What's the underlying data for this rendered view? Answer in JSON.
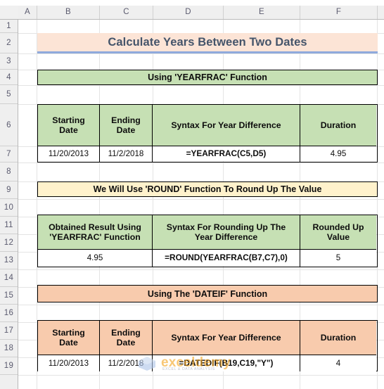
{
  "spreadsheet": {
    "columns": [
      "A",
      "B",
      "C",
      "D",
      "E",
      "F"
    ],
    "rows": [
      "1",
      "2",
      "3",
      "4",
      "5",
      "6",
      "7",
      "8",
      "9",
      "10",
      "11",
      "12",
      "13",
      "14",
      "15",
      "16",
      "17",
      "18",
      "19"
    ],
    "corner_name": "select-all-corner"
  },
  "title_banner": {
    "text": "Calculate Years Between Two Dates",
    "background": "#FCE4D6",
    "text_color": "#44546A",
    "underline_color": "#8FAADC",
    "cell_range": "B2:F2"
  },
  "section_1": {
    "banner": {
      "text": "Using 'YEARFRAC' Function",
      "background": "#C6E0B4",
      "cell_range": "B4:F4"
    },
    "table": {
      "headers": [
        "Starting Date",
        "Ending Date",
        "Syntax For Year Difference",
        "Duration"
      ],
      "header_lines": [
        [
          "Starting",
          "Date"
        ],
        [
          "Ending",
          "Date"
        ],
        [
          "Syntax For Year Difference"
        ],
        [
          "Duration"
        ]
      ],
      "header_background": "#C6E0B4",
      "row": [
        "11/20/2013",
        "11/2/2018",
        "=YEARFRAC(C5,D5)",
        "4.95"
      ],
      "cell_range": "B6:F7"
    }
  },
  "section_2": {
    "banner": {
      "text": "We Will Use 'ROUND' Function To Round Up The Value",
      "background": "#FFF2CC",
      "cell_range": "B9:F9"
    },
    "table": {
      "headers": [
        "Obtained Result Using 'YEARFRAC' Function",
        "Syntax For Rounding Up The Year Difference",
        "Rounded Up Value"
      ],
      "header_lines": [
        [
          "Obtained Result Using",
          "'YEARFRAC' Function"
        ],
        [
          "Syntax For Rounding Up The",
          "Year Difference"
        ],
        [
          "Rounded Up",
          "Value"
        ]
      ],
      "header_background": "#C6E0B4",
      "row": [
        "4.95",
        "=ROUND(YEARFRAC(B7,C7),0)",
        "5"
      ],
      "cell_range": "B11:F13"
    }
  },
  "section_3": {
    "banner": {
      "text": "Using The 'DATEIF' Function",
      "background": "#F8CBAD",
      "cell_range": "B15:F15"
    },
    "table": {
      "headers": [
        "Starting Date",
        "Ending Date",
        "Syntax For Year Difference",
        "Duration"
      ],
      "header_lines": [
        [
          "Starting",
          "Date"
        ],
        [
          "Ending",
          "Date"
        ],
        [
          "Syntax For Year Difference"
        ],
        [
          "Duration"
        ]
      ],
      "header_background": "#F8CBAD",
      "row": [
        "11/20/2013",
        "11/2/2018",
        "=DATEDIF(B19,C19,\"Y\")",
        "4"
      ],
      "cell_range": "B17:F19"
    }
  },
  "watermark": {
    "text": "exceldemy",
    "subtext": "EXCEL & DATA ANALYSIS",
    "text_color": "#F5A623",
    "logo_color": "#AFC6E9"
  }
}
